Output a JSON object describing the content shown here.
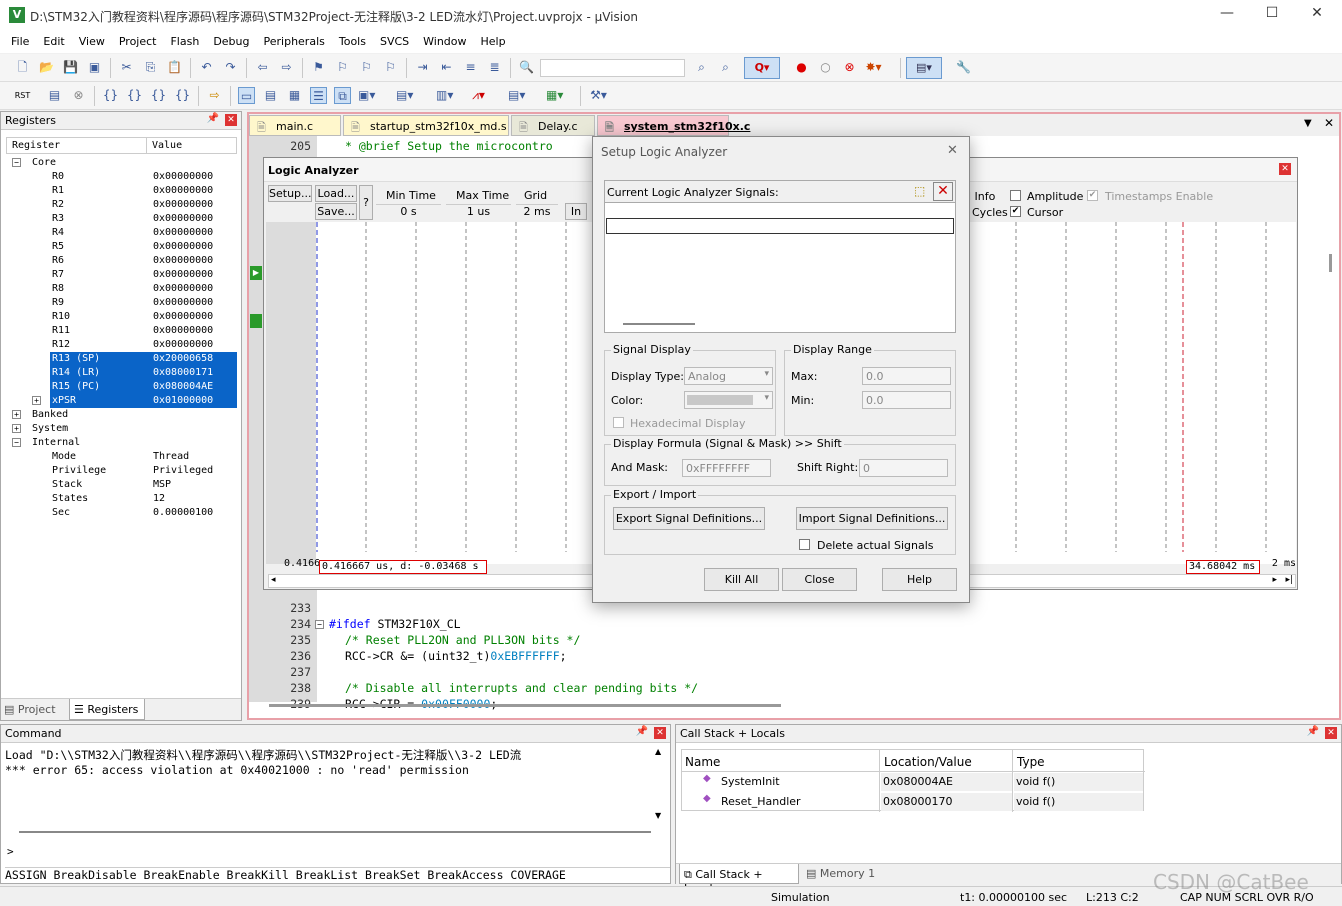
{
  "window": {
    "title": "D:\\STM32入门教程资料\\程序源码\\程序源码\\STM32Project-无注释版\\3-2 LED流水灯\\Project.uvprojx - µVision"
  },
  "menu": [
    "File",
    "Edit",
    "View",
    "Project",
    "Flash",
    "Debug",
    "Peripherals",
    "Tools",
    "SVCS",
    "Window",
    "Help"
  ],
  "registers": {
    "title": "Registers",
    "col_register": "Register",
    "col_value": "Value",
    "core_label": "Core",
    "core": [
      {
        "name": "R0",
        "value": "0x00000000"
      },
      {
        "name": "R1",
        "value": "0x00000000"
      },
      {
        "name": "R2",
        "value": "0x00000000"
      },
      {
        "name": "R3",
        "value": "0x00000000"
      },
      {
        "name": "R4",
        "value": "0x00000000"
      },
      {
        "name": "R5",
        "value": "0x00000000"
      },
      {
        "name": "R6",
        "value": "0x00000000"
      },
      {
        "name": "R7",
        "value": "0x00000000"
      },
      {
        "name": "R8",
        "value": "0x00000000"
      },
      {
        "name": "R9",
        "value": "0x00000000"
      },
      {
        "name": "R10",
        "value": "0x00000000"
      },
      {
        "name": "R11",
        "value": "0x00000000"
      },
      {
        "name": "R12",
        "value": "0x00000000"
      },
      {
        "name": "R13 (SP)",
        "value": "0x20000658"
      },
      {
        "name": "R14 (LR)",
        "value": "0x08000171"
      },
      {
        "name": "R15 (PC)",
        "value": "0x080004AE"
      },
      {
        "name": "xPSR",
        "value": "0x01000000"
      }
    ],
    "banked": "Banked",
    "system": "System",
    "internal": "Internal",
    "internal_items": [
      {
        "name": "Mode",
        "value": "Thread"
      },
      {
        "name": "Privilege",
        "value": "Privileged"
      },
      {
        "name": "Stack",
        "value": "MSP"
      },
      {
        "name": "States",
        "value": "12"
      },
      {
        "name": "Sec",
        "value": "0.00000100"
      }
    ],
    "tab_project": "Project",
    "tab_registers": "Registers"
  },
  "editor": {
    "tabs": [
      "main.c",
      "startup_stm32f10x_md.s",
      "Delay.c",
      "system_stm32f10x.c"
    ],
    "line205": {
      "num": "205",
      "text": " * @brief  Setup the microcontro"
    },
    "lines": [
      {
        "num": "233",
        "parts": [
          {
            "t": "",
            "c": ""
          }
        ]
      },
      {
        "num": "234",
        "parts": [
          {
            "t": "#ifdef",
            "c": "kw"
          },
          {
            "t": " STM32F10X_CL",
            "c": ""
          }
        ]
      },
      {
        "num": "235",
        "parts": [
          {
            "t": "  /* Reset PLL2ON and PLL3ON bits */",
            "c": "cm"
          }
        ]
      },
      {
        "num": "236",
        "parts": [
          {
            "t": "  RCC->CR &= (uint32_t)",
            "c": ""
          },
          {
            "t": "0xEBFFFFFF",
            "c": "hx"
          },
          {
            "t": ";",
            "c": ""
          }
        ]
      },
      {
        "num": "237",
        "parts": [
          {
            "t": "",
            "c": ""
          }
        ]
      },
      {
        "num": "238",
        "parts": [
          {
            "t": "  /* Disable all interrupts and clear pending bits  */",
            "c": "cm"
          }
        ]
      },
      {
        "num": "239",
        "parts": [
          {
            "t": "  RCC->CIR = ",
            "c": ""
          },
          {
            "t": "0x00FF0000",
            "c": "hx"
          },
          {
            "t": ";",
            "c": ""
          }
        ]
      }
    ]
  },
  "la": {
    "title": "Logic Analyzer",
    "setup": "Setup...",
    "load": "Load...",
    "save": "Save...",
    "help": "?",
    "min_time_label": "Min Time",
    "min_time": "0 s",
    "max_time_label": "Max Time",
    "max_time": "1 us",
    "grid_label": "Grid",
    "grid": "2 ms",
    "zoom_in": "In",
    "info": "l Info",
    "cycles": "Cycles",
    "amplitude": "Amplitude",
    "cursor": "Cursor",
    "timestamps": "Timestamps Enable",
    "cursor_left": "0.416667 us,  d: -0.03468 s",
    "left_value": "0.4166",
    "right_value": "34.68042 ms",
    "right_value2": "2 ms"
  },
  "dialog": {
    "title": "Setup Logic Analyzer",
    "current_signals": "Current Logic Analyzer Signals:",
    "signal_display": "Signal Display",
    "display_type_label": "Display Type:",
    "display_type": "Analog",
    "color_label": "Color:",
    "hex_display": "Hexadecimal Display",
    "display_range": "Display Range",
    "max_label": "Max:",
    "max": "0.0",
    "min_label": "Min:",
    "min": "0.0",
    "formula": "Display Formula (Signal & Mask) >> Shift",
    "and_mask_label": "And Mask:",
    "and_mask": "0xFFFFFFFF",
    "shift_label": "Shift Right:",
    "shift": "0",
    "export_import": "Export / Import",
    "export_btn": "Export Signal Definitions...",
    "import_btn": "Import Signal Definitions...",
    "delete_signals": "Delete actual Signals",
    "kill_all": "Kill All",
    "close": "Close",
    "help": "Help"
  },
  "command": {
    "title": "Command",
    "line1": "Load \"D:\\\\STM32入门教程资料\\\\程序源码\\\\程序源码\\\\STM32Project-无注释版\\\\3-2 LED流",
    "line2": "*** error 65: access violation at 0x40021000 : no 'read' permission",
    "prompt": ">",
    "hints": "ASSIGN BreakDisable BreakEnable BreakKill BreakList BreakSet BreakAccess COVERAGE"
  },
  "callstack": {
    "title": "Call Stack + Locals",
    "col_name": "Name",
    "col_loc": "Location/Value",
    "col_type": "Type",
    "rows": [
      {
        "name": "SystemInit",
        "loc": "0x080004AE",
        "type": "void f()"
      },
      {
        "name": "Reset_Handler",
        "loc": "0x08000170",
        "type": "void f()"
      }
    ],
    "tab_callstack": "Call Stack + Locals",
    "tab_memory": "Memory 1"
  },
  "status": {
    "sim": "Simulation",
    "t1": "t1: 0.00000100 sec",
    "pos": "L:213 C:2",
    "caps": "CAP  NUM  SCRL  OVR  R/O",
    "watermark": "CSDN @CatBee"
  }
}
